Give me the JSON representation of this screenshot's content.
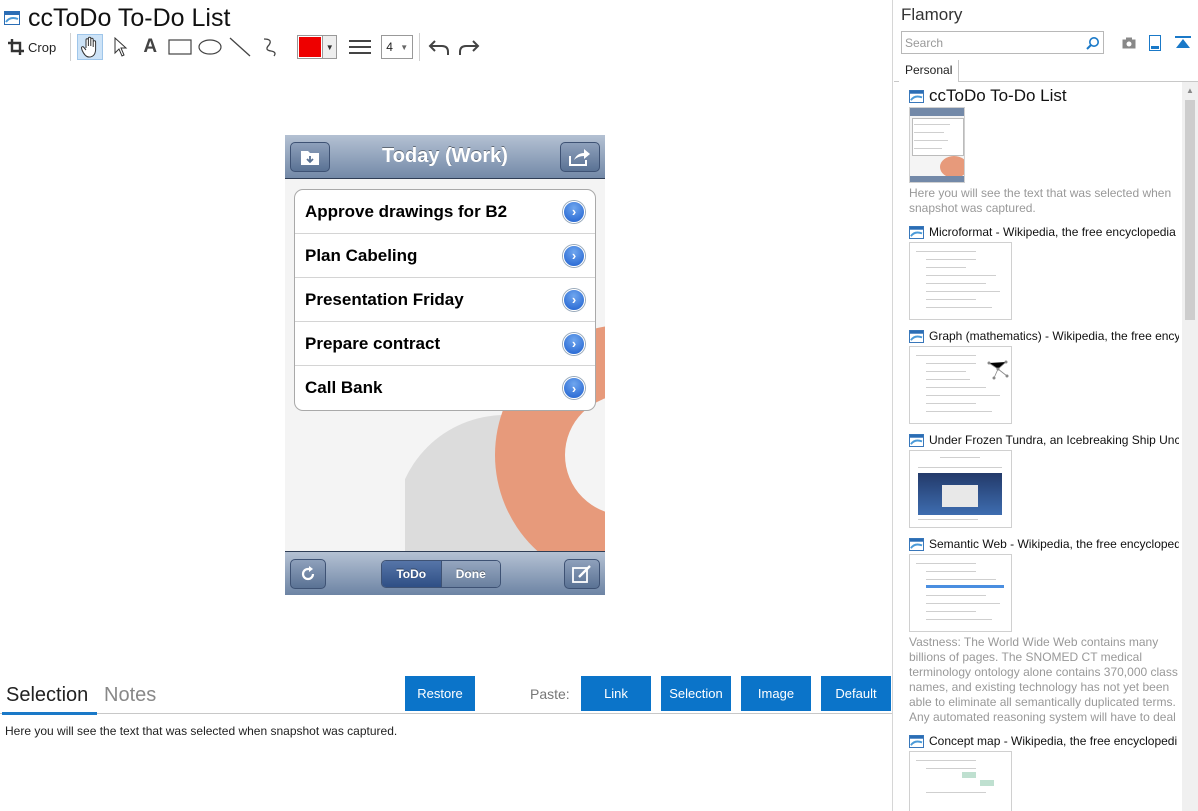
{
  "window": {
    "title": "ccToDo To-Do List"
  },
  "toolbar": {
    "crop_label": "Crop",
    "pen_color": "#ee0000",
    "stroke_width": "4"
  },
  "phone": {
    "nav_title": "Today (Work)",
    "items": [
      {
        "label": "Approve drawings for B2"
      },
      {
        "label": "Plan Cabeling"
      },
      {
        "label": "Presentation Friday"
      },
      {
        "label": "Prepare contract"
      },
      {
        "label": "Call Bank"
      }
    ],
    "segment_todo": "ToDo",
    "segment_done": "Done"
  },
  "bottom": {
    "tab_selection": "Selection",
    "tab_notes": "Notes",
    "restore_label": "Restore",
    "paste_label": "Paste:",
    "link_label": "Link",
    "selection_label": "Selection",
    "image_label": "Image",
    "default_label": "Default",
    "selection_text": "Here you will see the text that was selected when snapshot was captured."
  },
  "sidebar": {
    "title": "Flamory",
    "search_placeholder": "Search",
    "tab_personal": "Personal",
    "entries": [
      {
        "title": "ccToDo To-Do List",
        "note": "Here you will see the text that was selected when snapshot was captured."
      },
      {
        "title": "Microformat - Wikipedia, the free encyclopedia",
        "note": ""
      },
      {
        "title": "Graph (mathematics) - Wikipedia, the free encyc",
        "note": ""
      },
      {
        "title": "Under Frozen Tundra, an Icebreaking Ship Unco",
        "note": ""
      },
      {
        "title": "Semantic Web - Wikipedia, the free encycloped",
        "note": "Vastness: The World Wide Web contains many billions of pages. The SNOMED CT medical terminology ontology alone contains 370,000 class names, and existing technology has not yet been able to eliminate all semantically duplicated terms. Any automated reasoning system will have to deal with truly huge inputs."
      },
      {
        "title": "Concept map - Wikipedia, the free encyclopedi",
        "note": ""
      }
    ]
  }
}
